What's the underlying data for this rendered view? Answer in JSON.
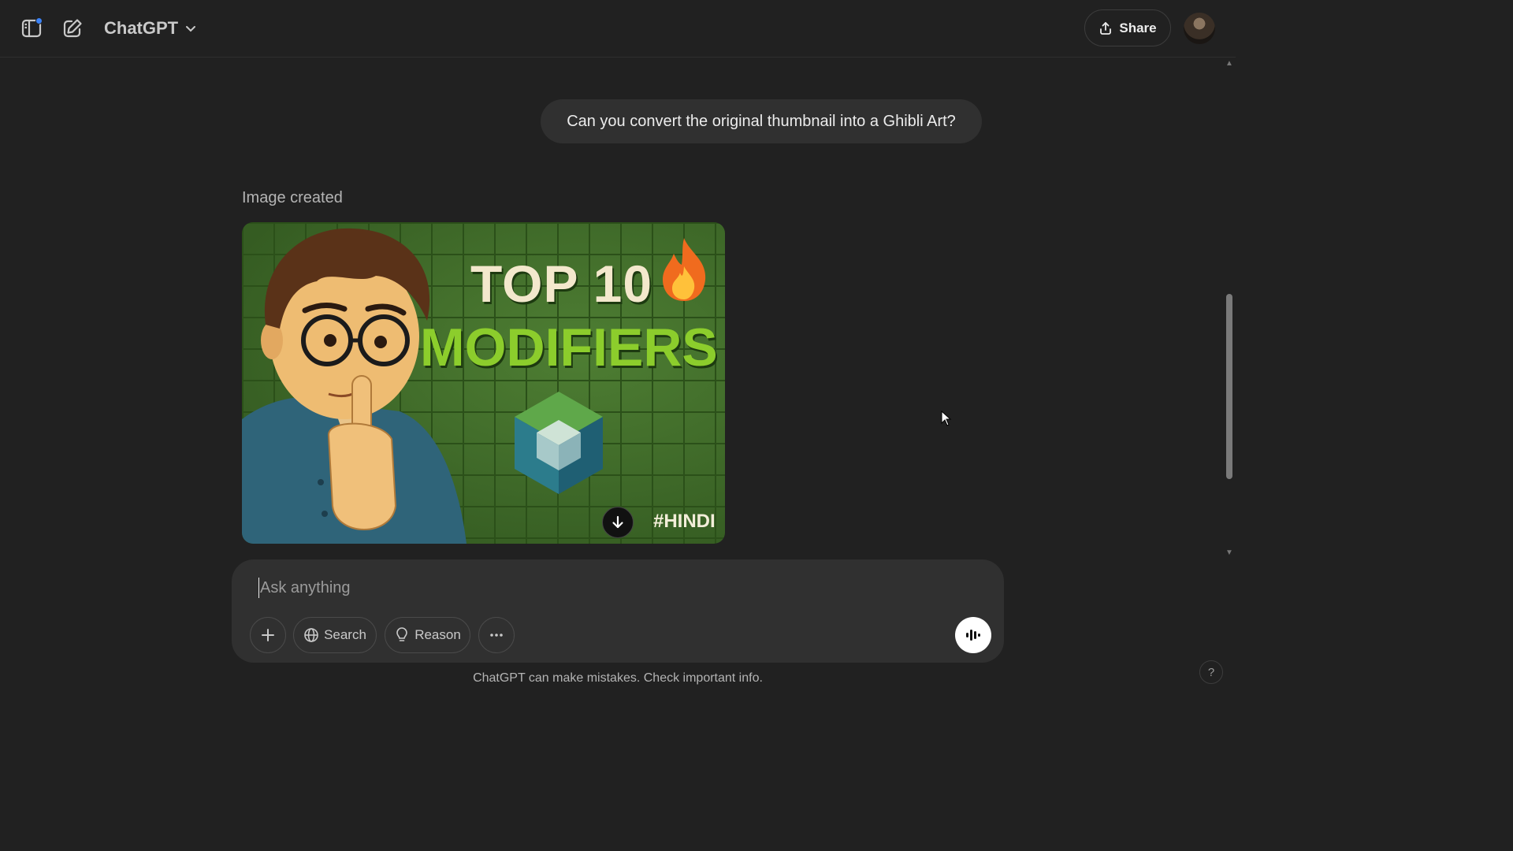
{
  "header": {
    "model_name": "ChatGPT",
    "share_label": "Share"
  },
  "conversation": {
    "user_message": "Can you convert the original thumbnail into a Ghibli Art?",
    "assistant_status": "Image created",
    "image": {
      "title_line1": "TOP 10",
      "title_line2": "MODIFIERS",
      "hashtag": "#HINDI"
    }
  },
  "composer": {
    "placeholder": "Ask anything",
    "buttons": {
      "search": "Search",
      "reason": "Reason"
    }
  },
  "footer": {
    "disclaimer": "ChatGPT can make mistakes. Check important info.",
    "help": "?"
  },
  "colors": {
    "background": "#212121",
    "surface": "#303030",
    "notification_dot": "#3b82f6"
  }
}
